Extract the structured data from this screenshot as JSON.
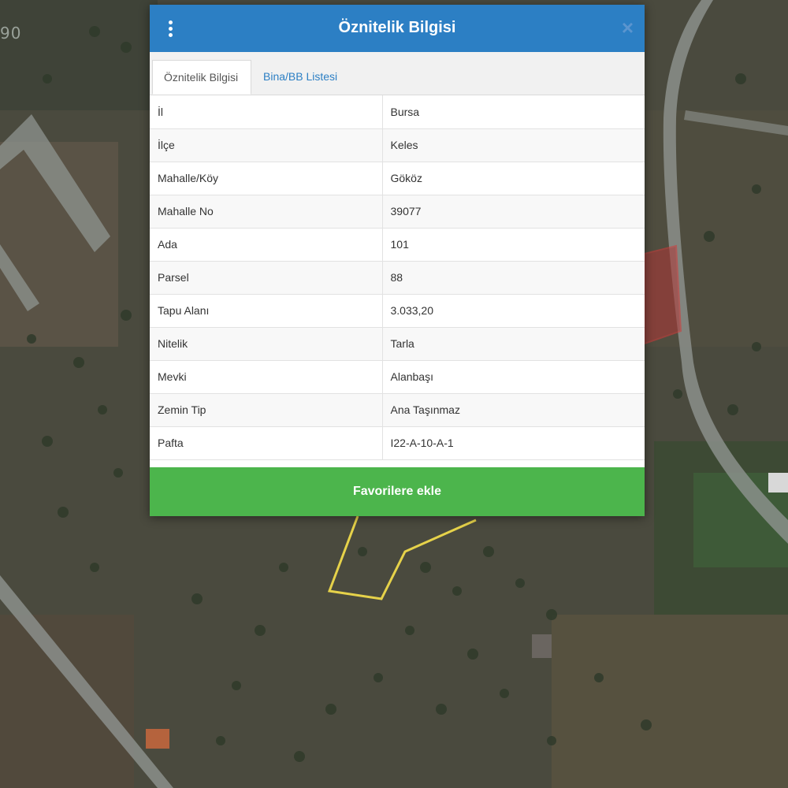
{
  "map": {
    "corner_text": "90",
    "colors": {
      "ground": "#4a4a3e",
      "road": "#8f9490",
      "parcel_outline": "#e6d24a",
      "parcel_fill": "#b03636"
    }
  },
  "dialog": {
    "title": "Öznitelik Bilgisi",
    "tabs": [
      "Öznitelik Bilgisi",
      "Bina/BB Listesi"
    ],
    "rows": [
      {
        "key": "İl",
        "value": "Bursa"
      },
      {
        "key": "İlçe",
        "value": "Keles"
      },
      {
        "key": "Mahalle/Köy",
        "value": "Gököz"
      },
      {
        "key": "Mahalle No",
        "value": "39077"
      },
      {
        "key": "Ada",
        "value": "101"
      },
      {
        "key": "Parsel",
        "value": "88"
      },
      {
        "key": "Tapu Alanı",
        "value": "3.033,20"
      },
      {
        "key": "Nitelik",
        "value": "Tarla"
      },
      {
        "key": "Mevki",
        "value": "Alanbaşı"
      },
      {
        "key": "Zemin Tip",
        "value": "Ana Taşınmaz"
      },
      {
        "key": "Pafta",
        "value": "I22-A-10-A-1"
      }
    ],
    "favorite_button": "Favorilere ekle",
    "colors": {
      "header": "#2c7fc4",
      "button": "#4cb54c",
      "tab_link": "#2c7fc4"
    }
  }
}
